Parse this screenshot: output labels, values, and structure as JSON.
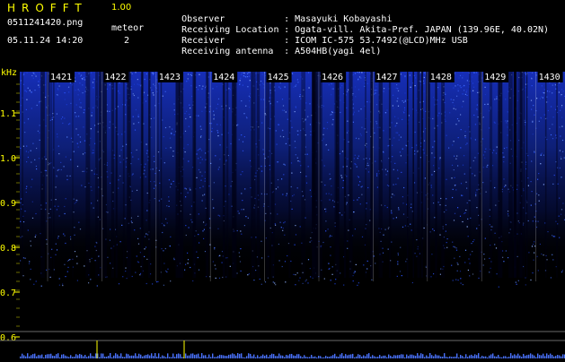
{
  "app": {
    "name": "HROFFT",
    "version": "1.00"
  },
  "file": {
    "name": "0511241420.png",
    "datetime": "05.11.24 14:20"
  },
  "meteor": {
    "label": "meteor",
    "count": "2"
  },
  "info": [
    {
      "key": "Observer",
      "value": "Masayuki Kobayashi"
    },
    {
      "key": "Receiving Location",
      "value": "Ogata-vill. Akita-Pref. JAPAN (139.96E, 40.02N)"
    },
    {
      "key": "Receiver",
      "value": "ICOM IC-575 53.7492(@LCD)MHz USB"
    },
    {
      "key": "Receiving antenna",
      "value": "A504HB(yagi 4el)"
    }
  ],
  "spectrogram": {
    "unit_label": "kHz",
    "freq_ticks": [
      "1.1",
      "1.0",
      "0.9",
      "0.8",
      "0.7",
      "0.6"
    ],
    "time_labels": [
      "1421",
      "1422",
      "1423",
      "1424",
      "1425",
      "1426",
      "1427",
      "1428",
      "1429",
      "1430"
    ]
  },
  "colors": {
    "header_title": "#ffff00",
    "label": "#ffff00",
    "text": "#ffffff",
    "background": "#000000",
    "signal": "#2a52ff"
  }
}
